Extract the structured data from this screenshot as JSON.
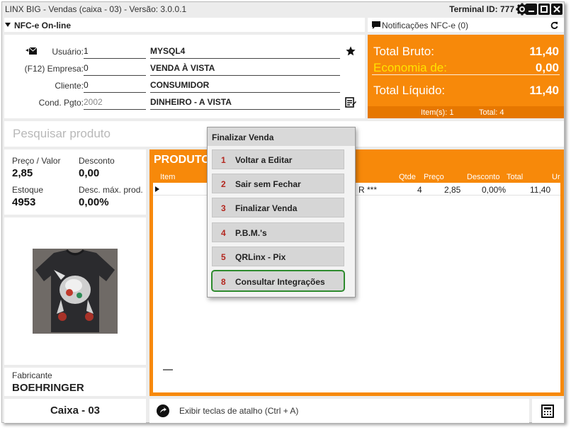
{
  "window": {
    "title": "LINX BIG - Vendas (caixa - 03) - Versão: 3.0.0.1",
    "terminal": "Terminal ID: 777"
  },
  "nfce": {
    "label": "NFC-e On-line"
  },
  "notifications": {
    "label": "Notificações NFC-e (0)"
  },
  "form": {
    "usuario": {
      "label": "Usuário:",
      "code": "1",
      "desc": "MYSQL4"
    },
    "empresa": {
      "label": "(F12) Empresa:",
      "code": "0",
      "desc": "VENDA À VISTA"
    },
    "cliente": {
      "label": "Cliente:",
      "code": "0",
      "desc": "CONSUMIDOR"
    },
    "cond": {
      "label": "Cond. Pgto:",
      "code": "2002",
      "desc": "DINHEIRO - A VISTA"
    }
  },
  "totals": {
    "bruto_label": "Total Bruto:",
    "bruto": "11,40",
    "economia_label": "Economia de:",
    "economia": "0,00",
    "liquido_label": "Total Líquido:",
    "liquido": "11,40",
    "itens": "Item(s): 1",
    "total": "Total: 4"
  },
  "search": {
    "placeholder": "Pesquisar produto"
  },
  "info": {
    "preco_label": "Preço / Valor",
    "preco": "2,85",
    "desconto_label": "Desconto",
    "desconto": "0,00",
    "estoque_label": "Estoque",
    "estoque": "4953",
    "descmax_label": "Desc. máx. prod.",
    "descmax": "0,00%"
  },
  "fabricante": {
    "label": "Fabricante",
    "value": "BOEHRINGER"
  },
  "products": {
    "title": "PRODUTO",
    "headers": {
      "item": "Item",
      "qtde": "Qtde",
      "preco": "Preço",
      "desconto": "Desconto",
      "total": "Total",
      "un": "Ur"
    },
    "row": {
      "desc_tail": "R ***",
      "qtde": "4",
      "preco": "2,85",
      "desconto": "0,00%",
      "total": "11,40"
    }
  },
  "footer": {
    "caixa": "Caixa - 03",
    "shortcut": "Exibir teclas de atalho (Ctrl + A)"
  },
  "modal": {
    "title": "Finalizar Venda",
    "options": [
      {
        "num": "1",
        "label": "Voltar a Editar"
      },
      {
        "num": "2",
        "label": "Sair sem Fechar"
      },
      {
        "num": "3",
        "label": "Finalizar Venda"
      },
      {
        "num": "4",
        "label": "P.B.M.'s"
      },
      {
        "num": "5",
        "label": "QRLinx - Pix"
      },
      {
        "num": "8",
        "label": "Consultar Integrações"
      }
    ]
  },
  "colors": {
    "accent": "#f7890a",
    "economy": "#ffe300",
    "selected_border": "#2e8b2e",
    "option_number": "#b3261e"
  }
}
